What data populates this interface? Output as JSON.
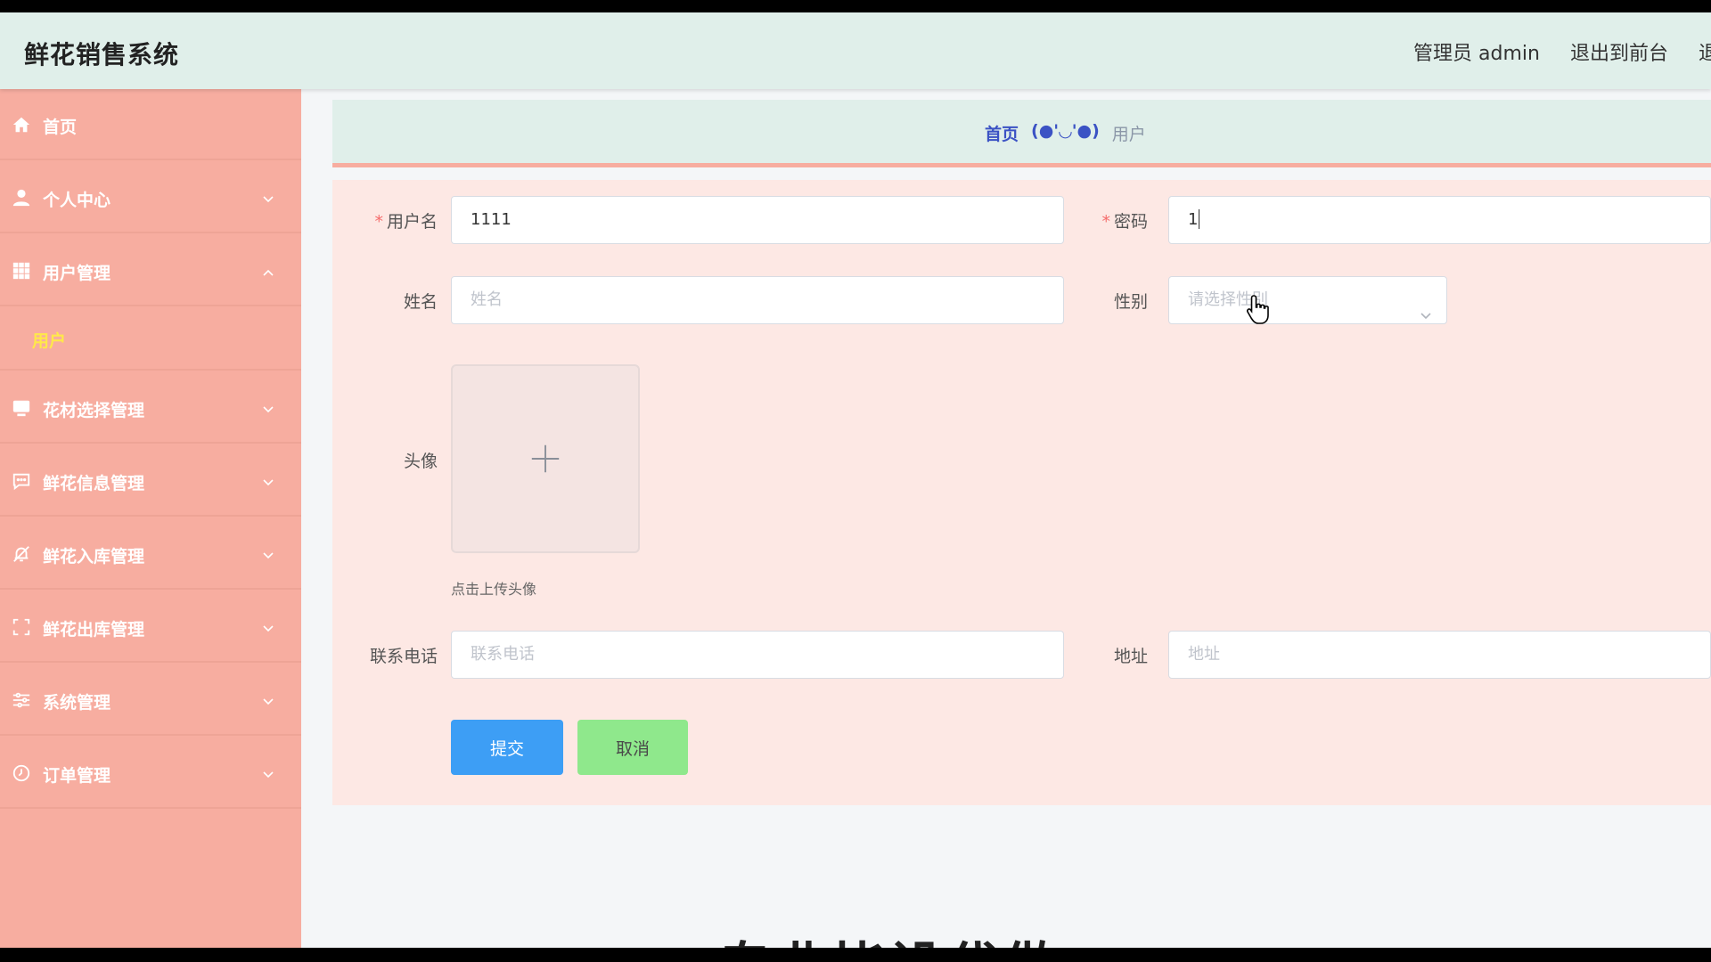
{
  "header": {
    "title": "鲜花销售系统",
    "admin_label": "管理员 admin",
    "back_to_front": "退出到前台",
    "logout_cut": "退出"
  },
  "sidebar": {
    "items": [
      {
        "label": "首页",
        "icon": "home-icon"
      },
      {
        "label": "个人中心",
        "icon": "user-icon"
      },
      {
        "label": "用户管理",
        "icon": "grid-icon",
        "expanded": true
      },
      {
        "label": "花材选择管理",
        "icon": "monitor-icon"
      },
      {
        "label": "鲜花信息管理",
        "icon": "chat-icon"
      },
      {
        "label": "鲜花入库管理",
        "icon": "bell-off-icon"
      },
      {
        "label": "鲜花出库管理",
        "icon": "fullscreen-icon"
      },
      {
        "label": "系统管理",
        "icon": "sliders-icon"
      },
      {
        "label": "订单管理",
        "icon": "clock-icon"
      }
    ],
    "sub_item": "用户"
  },
  "breadcrumb": {
    "home": "首页",
    "sep": "(●'◡'●)",
    "current": "用户"
  },
  "form": {
    "username_label": "用户名",
    "username_value": "1111",
    "password_label": "密码",
    "password_value": "1",
    "name_label": "姓名",
    "name_placeholder": "姓名",
    "gender_label": "性别",
    "gender_placeholder": "请选择性别",
    "avatar_label": "头像",
    "avatar_hint": "点击上传头像",
    "phone_label": "联系电话",
    "phone_placeholder": "联系电话",
    "address_label": "地址",
    "address_placeholder": "地址",
    "submit": "提交",
    "cancel": "取消"
  },
  "overlay_text": "专业毕设代做"
}
